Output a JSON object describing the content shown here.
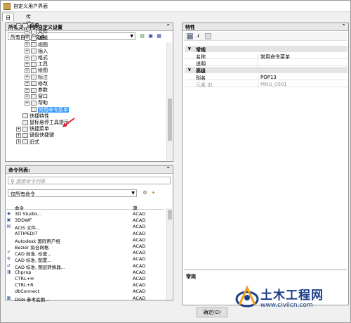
{
  "window": {
    "title": "自定义用户界面"
  },
  "tabs": [
    {
      "label": "自定义"
    },
    {
      "label": "传输"
    }
  ],
  "left_panel": {
    "header": "所有文件中的自定义设置",
    "combo_value": "所有自定义文件",
    "tree": [
      {
        "label": "菜单",
        "level": 1,
        "expander": "−"
      },
      {
        "label": "文件",
        "level": 2,
        "expander": "+"
      },
      {
        "label": "编辑",
        "level": 2,
        "expander": "+"
      },
      {
        "label": "视图",
        "level": 2,
        "expander": "+"
      },
      {
        "label": "插入",
        "level": 2,
        "expander": "+"
      },
      {
        "label": "格式",
        "level": 2,
        "expander": "+"
      },
      {
        "label": "工具",
        "level": 2,
        "expander": "+"
      },
      {
        "label": "绘图",
        "level": 2,
        "expander": "+"
      },
      {
        "label": "标注",
        "level": 2,
        "expander": "+"
      },
      {
        "label": "修改",
        "level": 2,
        "expander": "+"
      },
      {
        "label": "参数",
        "level": 2,
        "expander": "+"
      },
      {
        "label": "窗口",
        "level": 2,
        "expander": "+"
      },
      {
        "label": "帮助",
        "level": 2,
        "expander": "+"
      },
      {
        "label": "常用命令菜单",
        "level": 2,
        "expander": "",
        "selected": true
      },
      {
        "label": "快捷特性",
        "level": 1,
        "expander": ""
      },
      {
        "label": "鼠标悬停工具提示",
        "level": 1,
        "expander": ""
      },
      {
        "label": "快捷菜单",
        "level": 1,
        "expander": "+"
      },
      {
        "label": "键盘快捷键",
        "level": 1,
        "expander": "+"
      },
      {
        "label": "旧式",
        "level": 1,
        "expander": "+"
      }
    ]
  },
  "command_panel": {
    "header": "命令列表:",
    "search_placeholder": "搜索命令列表",
    "filter_value": "仅所有命令",
    "col_command": "命令",
    "col_source": "源",
    "rows": [
      {
        "icon": "3d",
        "name": "3D Studio...",
        "source": "ACAD"
      },
      {
        "icon": "3dwf",
        "name": "3DDWF",
        "source": "ACAD"
      },
      {
        "icon": "acis",
        "name": "ACIS 文件...",
        "source": "ACAD"
      },
      {
        "icon": "",
        "name": "ATTIPEDIT",
        "source": "ACAD"
      },
      {
        "icon": "",
        "name": "Autodesk 国际用户组",
        "source": "ACAD"
      },
      {
        "icon": "",
        "name": "Bezier 拟合网格",
        "source": "ACAD"
      },
      {
        "icon": "check",
        "name": "CAD 标准, 检查...",
        "source": "ACAD"
      },
      {
        "icon": "cfg",
        "name": "CAD 标准, 配置...",
        "source": "ACAD"
      },
      {
        "icon": "conv",
        "name": "CAD 标准, 图层转换器...",
        "source": "ACAD"
      },
      {
        "icon": "chprop",
        "name": "Chprop",
        "source": "ACAD"
      },
      {
        "icon": "",
        "name": "CTRL+H",
        "source": "ACAD"
      },
      {
        "icon": "",
        "name": "CTRL+R",
        "source": "ACAD"
      },
      {
        "icon": "",
        "name": "dbConnect",
        "source": "ACAD"
      },
      {
        "icon": "dgn",
        "name": "DGN 参考底图...",
        "source": "ACAD"
      }
    ]
  },
  "props_panel": {
    "header": "特性",
    "categories": [
      {
        "title": "常规",
        "rows": [
          {
            "name": "名称",
            "value": "常用命令菜单",
            "dim": false
          },
          {
            "name": "说明",
            "value": "",
            "dim": false
          }
        ]
      },
      {
        "title": "高级",
        "rows": [
          {
            "name": "别名",
            "value": "POP13",
            "dim": false
          },
          {
            "name": "元素 ID",
            "value": "MNU_0001",
            "dim": true
          }
        ]
      }
    ],
    "bottom_section_title": "常规"
  },
  "buttons": {
    "ok": "确定(O)"
  },
  "watermark": {
    "text": "土木工程网",
    "url": "www.civilcn.com"
  },
  "colors": {
    "selection": "#3399ff",
    "arrow": "#e0203a",
    "watermark": "#1b3f8a"
  }
}
